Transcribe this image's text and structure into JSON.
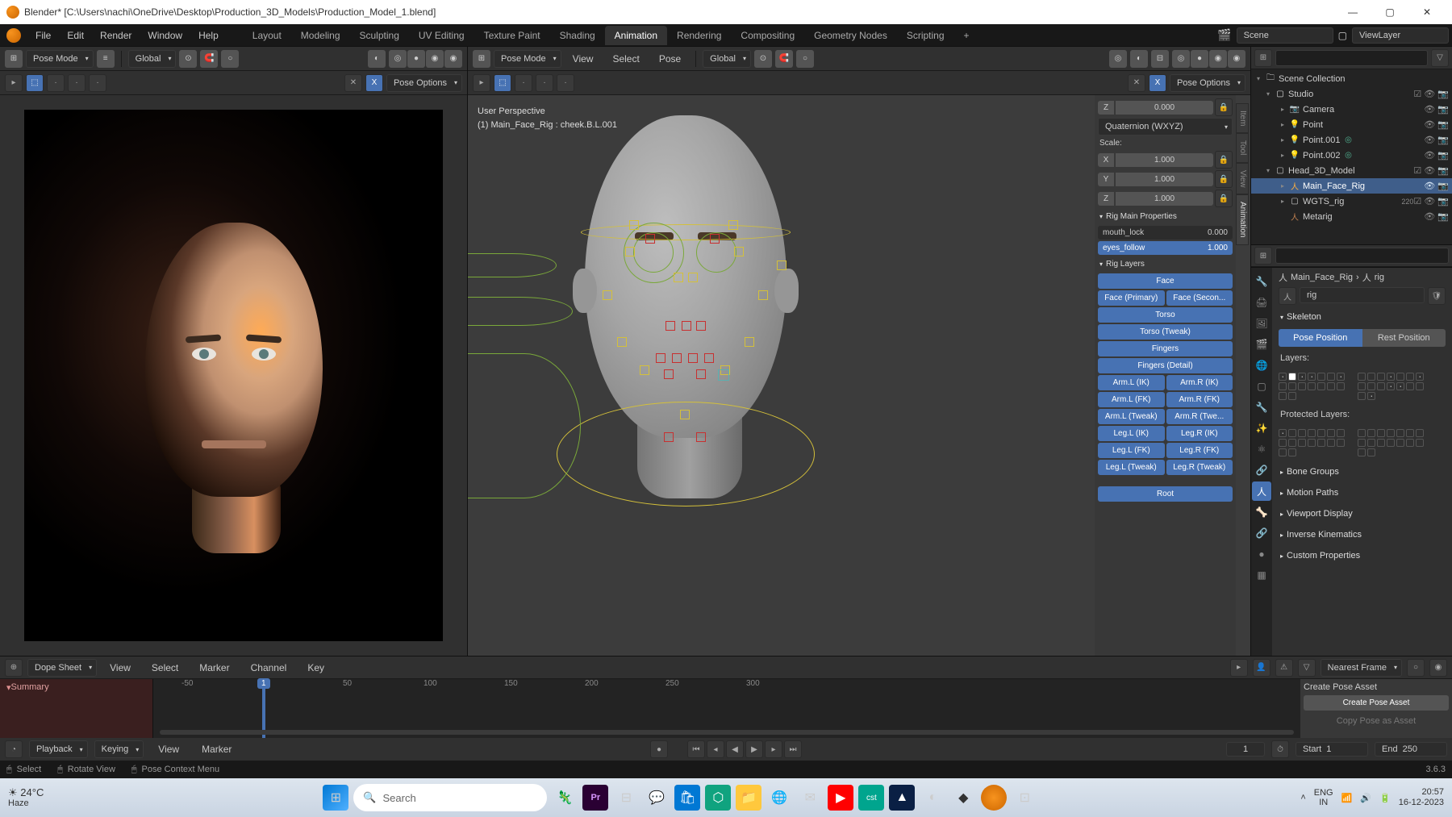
{
  "title": "Blender* [C:\\Users\\nachi\\OneDrive\\Desktop\\Production_3D_Models\\Production_Model_1.blend]",
  "menu": {
    "file": "File",
    "edit": "Edit",
    "render": "Render",
    "window": "Window",
    "help": "Help"
  },
  "workspaces": [
    "Layout",
    "Modeling",
    "Sculpting",
    "UV Editing",
    "Texture Paint",
    "Shading",
    "Animation",
    "Rendering",
    "Compositing",
    "Geometry Nodes",
    "Scripting"
  ],
  "workspace_active": "Animation",
  "scene_label": "Scene",
  "viewlayer_label": "ViewLayer",
  "mode": "Pose Mode",
  "orientation": "Global",
  "header2": {
    "view": "View",
    "select": "Select",
    "pose": "Pose",
    "pose_options": "Pose Options"
  },
  "viewport": {
    "perspective": "User Perspective",
    "selection": "(1) Main_Face_Rig : cheek.B.L.001"
  },
  "npanel": {
    "loc_z": "0.000",
    "rot_mode": "Quaternion (WXYZ)",
    "scale": "Scale:",
    "sx": "1.000",
    "sy": "1.000",
    "sz": "1.000",
    "h1": "Rig Main Properties",
    "mouth_lock": "mouth_lock",
    "mouth_lock_v": "0.000",
    "eyes_follow": "eyes_follow",
    "eyes_follow_v": "1.000",
    "h2": "Rig Layers",
    "btns": {
      "face": "Face",
      "facep": "Face (Primary)",
      "faces": "Face (Secon...",
      "torso": "Torso",
      "torsot": "Torso (Tweak)",
      "fingers": "Fingers",
      "fingersd": "Fingers (Detail)",
      "alik": "Arm.L (IK)",
      "arik": "Arm.R (IK)",
      "alfk": "Arm.L (FK)",
      "arfk": "Arm.R (FK)",
      "altw": "Arm.L (Tweak)",
      "artw": "Arm.R (Twe...",
      "llik": "Leg.L (IK)",
      "lrik": "Leg.R (IK)",
      "llfk": "Leg.L (FK)",
      "lrfk": "Leg.R (FK)",
      "lltw": "Leg.L (Tweak)",
      "lrtw": "Leg.R (Tweak)",
      "root": "Root"
    },
    "pose_asset_hdr": "Create Pose Asset",
    "create_pose": "Create Pose Asset",
    "copy_pose": "Copy Pose as Asset"
  },
  "vtabs": [
    "Item",
    "Tool",
    "View",
    "Animation"
  ],
  "outliner": {
    "root": "Scene Collection",
    "studio": "Studio",
    "camera": "Camera",
    "point": "Point",
    "point001": "Point.001",
    "point002": "Point.002",
    "head": "Head_3D_Model",
    "rig": "Main_Face_Rig",
    "wgts": "WGTS_rig",
    "wgts_count": "220",
    "metarig": "Metarig"
  },
  "properties": {
    "breadcrumb1": "Main_Face_Rig",
    "breadcrumb2": "rig",
    "name": "rig",
    "skeleton": "Skeleton",
    "pose_position": "Pose Position",
    "rest_position": "Rest Position",
    "layers": "Layers:",
    "protected": "Protected Layers:",
    "bone_groups": "Bone Groups",
    "motion_paths": "Motion Paths",
    "viewport_display": "Viewport Display",
    "ik": "Inverse Kinematics",
    "custom": "Custom Properties"
  },
  "dopesheet": {
    "label": "Dope Sheet",
    "view": "View",
    "select": "Select",
    "marker": "Marker",
    "channel": "Channel",
    "key": "Key",
    "summary": "Summary",
    "nearest": "Nearest Frame",
    "ticks": {
      "m50": "-50",
      "p50": "50",
      "p100": "100",
      "p150": "150",
      "p200": "200",
      "p250": "250",
      "p300": "300"
    },
    "playback": "Playback",
    "keying": "Keying",
    "view2": "View",
    "marker2": "Marker",
    "frame_current": "1",
    "start": "Start",
    "start_v": "1",
    "end": "End",
    "end_v": "250"
  },
  "status": {
    "select": "Select",
    "rotate": "Rotate View",
    "context": "Pose Context Menu",
    "version": "3.6.3"
  },
  "taskbar": {
    "temp": "24°C",
    "cond": "Haze",
    "search": "Search",
    "lang1": "ENG",
    "lang2": "IN",
    "time": "20:57",
    "date": "16-12-2023"
  }
}
